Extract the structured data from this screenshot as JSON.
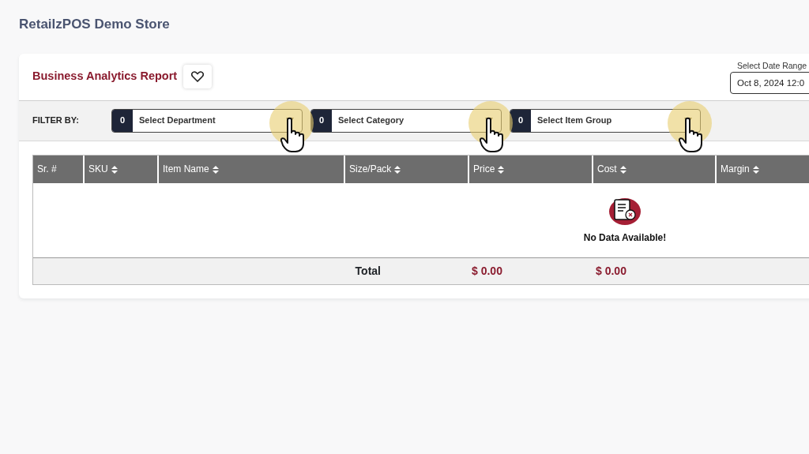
{
  "store": {
    "title": "RetailzPOS Demo Store"
  },
  "report": {
    "title": "Business Analytics Report",
    "favorite": false
  },
  "date_range": {
    "label": "Select Date Range",
    "value": "Oct 8, 2024 12:0"
  },
  "filter": {
    "label": "FILTER BY:",
    "selects": [
      {
        "count": "0",
        "placeholder": "Select Department",
        "pointer": true
      },
      {
        "count": "0",
        "placeholder": "Select Category",
        "pointer": true
      },
      {
        "count": "0",
        "placeholder": "Select Item Group",
        "pointer": true
      }
    ]
  },
  "table": {
    "columns": [
      {
        "label": "Sr. #",
        "sortable": false
      },
      {
        "label": "SKU",
        "sortable": true
      },
      {
        "label": "Item Name",
        "sortable": true
      },
      {
        "label": "Size/Pack",
        "sortable": true
      },
      {
        "label": "Price",
        "sortable": true
      },
      {
        "label": "Cost",
        "sortable": true
      },
      {
        "label": "Margin",
        "sortable": true
      }
    ],
    "empty_message": "No Data Available!",
    "totals": {
      "label": "Total",
      "price": "$ 0.00",
      "cost": "$ 0.00"
    }
  }
}
